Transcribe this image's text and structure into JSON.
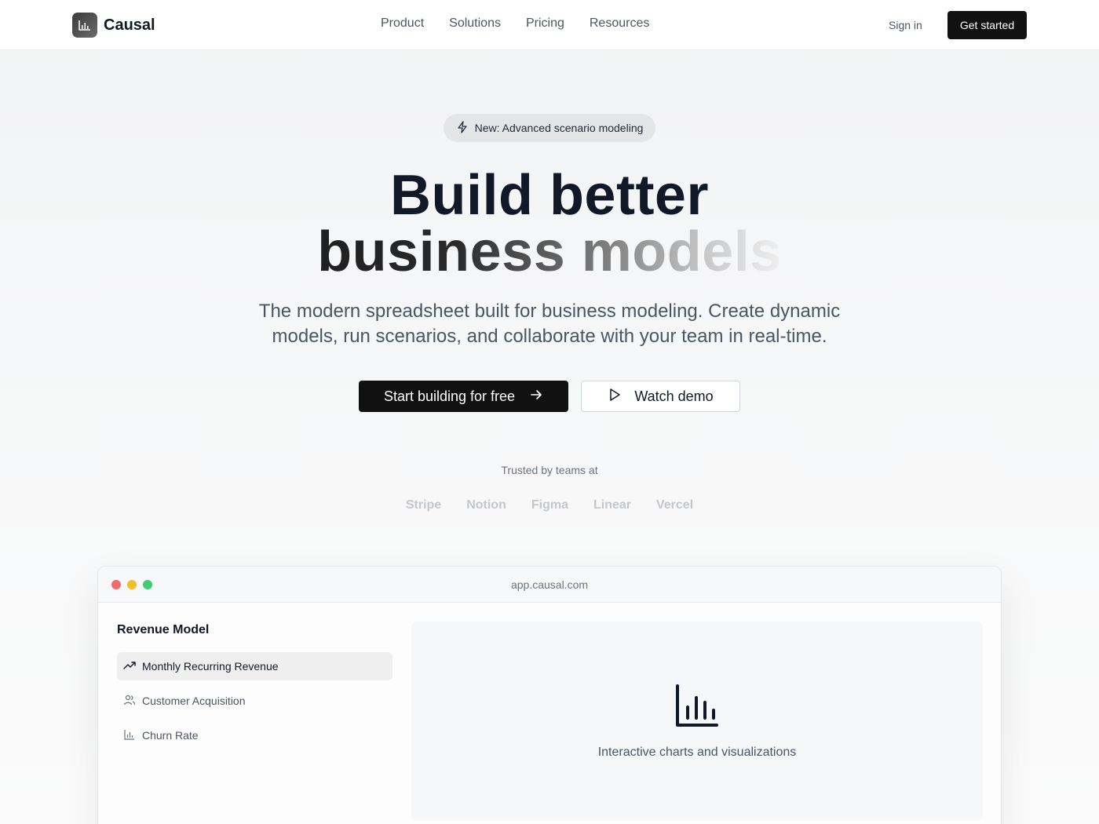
{
  "nav": {
    "brand": "Causal",
    "links": [
      "Product",
      "Solutions",
      "Pricing",
      "Resources"
    ],
    "sign_in": "Sign in",
    "cta": "Get started"
  },
  "hero": {
    "badge": "New: Advanced scenario modeling",
    "title_line1": "Build better",
    "title_line2": "business models",
    "subtitle_line1": "The modern spreadsheet built for business modeling. Create dynamic",
    "subtitle_line2": "models, run scenarios, and collaborate with your team in real-time.",
    "primary_button": "Start building for free",
    "secondary_button": "Watch demo"
  },
  "trusted": {
    "label": "Trusted by teams at",
    "companies": [
      "Stripe",
      "Notion",
      "Figma",
      "Linear",
      "Vercel"
    ]
  },
  "app_window": {
    "url": "app.causal.com",
    "sidebar_title": "Revenue Model",
    "items": [
      {
        "label": "Monthly Recurring Revenue",
        "icon": "trending-up-icon",
        "active": true
      },
      {
        "label": "Customer Acquisition",
        "icon": "users-icon",
        "active": false
      },
      {
        "label": "Churn Rate",
        "icon": "bar-chart-icon",
        "active": false
      }
    ],
    "panel_text": "Interactive charts and visualizations"
  },
  "colors": {
    "primary_button": "#111111",
    "background": "#f6f7f8",
    "traffic_red": "#ef6a6a",
    "traffic_yellow": "#f2be2a",
    "traffic_green": "#3dcf6f"
  }
}
